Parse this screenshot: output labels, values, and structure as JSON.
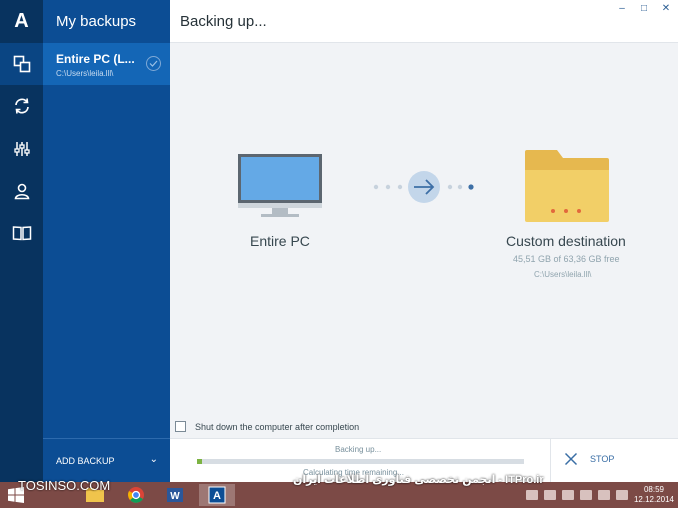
{
  "rail": {
    "logo": "A",
    "items": [
      "backups-icon",
      "sync-icon",
      "tools-icon",
      "account-icon",
      "help-book-icon"
    ]
  },
  "list": {
    "title": "My backups",
    "items": [
      {
        "title": "Entire PC (L...",
        "subtitle": "C:\\Users\\leila.lll\\"
      }
    ],
    "add_label": "ADD BACKUP"
  },
  "main": {
    "title": "Backing up...",
    "window_controls": [
      "–",
      "□",
      "✕"
    ],
    "source_label": "Entire PC",
    "destination_label": "Custom destination",
    "destination_free": "45,51 GB of 63,36 GB free",
    "destination_path": "C:\\Users\\leila.lll\\",
    "shutdown_label": "Shut down the computer after completion",
    "progress_status": "Backing up...",
    "progress_fraction": 0.015,
    "time_remaining": "Calculating time remaining...",
    "stop_label": "STOP"
  },
  "taskbar": {
    "clock_time": "08:59",
    "clock_date": "12.12.2014",
    "apps": [
      "file-explorer-icon",
      "chrome-icon",
      "word-icon",
      "acronis-icon"
    ]
  },
  "watermarks": {
    "left": "TOSINSO.COM",
    "right": "ITPro.ir - انجمن تخصصی فناوری اطلاعات ایران"
  },
  "colors": {
    "rail": "#08335f",
    "list": "#0c4d94",
    "selected": "#1466b6",
    "progress": "#7cb342",
    "monitor_screen": "#64a9e6",
    "folder": "#f2cf67"
  }
}
